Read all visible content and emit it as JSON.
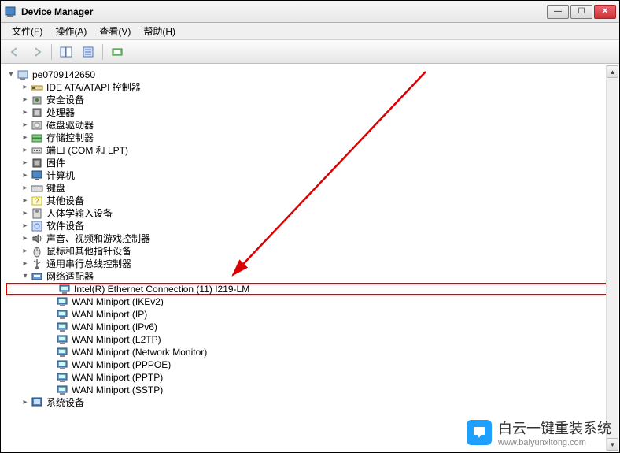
{
  "title": "Device Manager",
  "menu": {
    "file": "文件(F)",
    "action": "操作(A)",
    "view": "查看(V)",
    "help": "帮助(H)"
  },
  "tree": {
    "root": "pe0709142650",
    "categories": [
      {
        "label": "IDE ATA/ATAPI 控制器",
        "icon": "ide"
      },
      {
        "label": "安全设备",
        "icon": "security"
      },
      {
        "label": "处理器",
        "icon": "cpu"
      },
      {
        "label": "磁盘驱动器",
        "icon": "disk"
      },
      {
        "label": "存储控制器",
        "icon": "storage"
      },
      {
        "label": "端口 (COM 和 LPT)",
        "icon": "port"
      },
      {
        "label": "固件",
        "icon": "firmware"
      },
      {
        "label": "计算机",
        "icon": "computer"
      },
      {
        "label": "键盘",
        "icon": "keyboard"
      },
      {
        "label": "其他设备",
        "icon": "other"
      },
      {
        "label": "人体学输入设备",
        "icon": "hid"
      },
      {
        "label": "软件设备",
        "icon": "software"
      },
      {
        "label": "声音、视频和游戏控制器",
        "icon": "audio"
      },
      {
        "label": "鼠标和其他指针设备",
        "icon": "mouse"
      },
      {
        "label": "通用串行总线控制器",
        "icon": "usb"
      }
    ],
    "network": {
      "label": "网络适配器",
      "children": [
        "Intel(R) Ethernet Connection (11) I219-LM",
        "WAN Miniport (IKEv2)",
        "WAN Miniport (IP)",
        "WAN Miniport (IPv6)",
        "WAN Miniport (L2TP)",
        "WAN Miniport (Network Monitor)",
        "WAN Miniport (PPPOE)",
        "WAN Miniport (PPTP)",
        "WAN Miniport (SSTP)"
      ]
    },
    "last": {
      "label": "系统设备",
      "icon": "system"
    }
  },
  "watermark": {
    "brand": "白云一键重装系统",
    "url": "www.baiyunxitong.com"
  }
}
